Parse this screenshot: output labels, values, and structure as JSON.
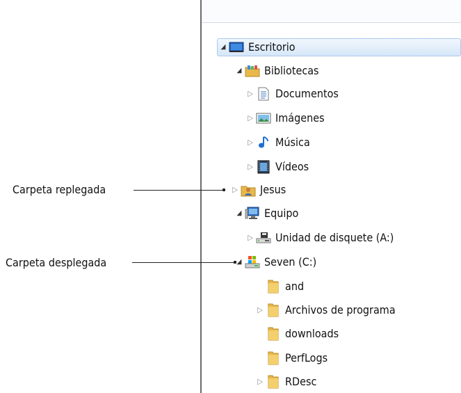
{
  "tree": {
    "escritorio": "Escritorio",
    "bibliotecas": "Bibliotecas",
    "documentos": "Documentos",
    "imagenes": "Imágenes",
    "musica": "Música",
    "videos": "Vídeos",
    "jesus": "Jesus",
    "equipo": "Equipo",
    "disquete": "Unidad de disquete (A:)",
    "seven": "Seven (C:)",
    "and": "and",
    "archivos": "Archivos de programa",
    "downloads": "downloads",
    "perflogs": "PerfLogs",
    "rdesc": "RDesc"
  },
  "callouts": {
    "collapsed": "Carpeta replegada",
    "expanded": "Carpeta desplegada"
  },
  "colors": {
    "selection_border": "#a9c9ec",
    "folder": "#e8b84a"
  }
}
